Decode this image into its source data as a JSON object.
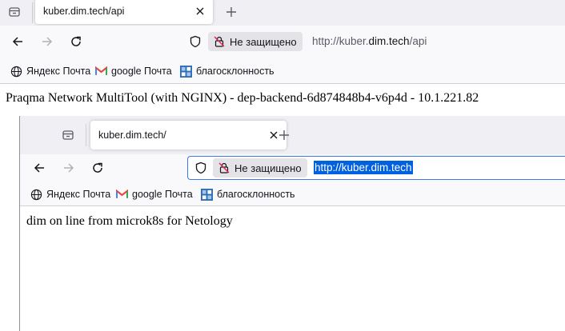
{
  "back_window": {
    "tab_title": "kuber.dim.tech/api",
    "security_label": "Не защищено",
    "url_prefix": "http://kuber.",
    "url_host": "dim.tech",
    "url_suffix": "/api",
    "bookmarks": [
      {
        "label": "Яндекс Почта",
        "icon": "globe-icon"
      },
      {
        "label": "google Почта",
        "icon": "gmail-icon"
      },
      {
        "label": "благосклонность",
        "icon": "grid-favicon"
      }
    ],
    "page_text": "Praqma Network MultiTool (with NGINX) - dep-backend-6d874848b4-v6p4d - 10.1.221.82"
  },
  "front_window": {
    "tab_title": "kuber.dim.tech/",
    "security_label": "Не защищено",
    "url": "http://kuber.dim.tech",
    "url_selected": true,
    "bookmarks": [
      {
        "label": "Яндекс Почта",
        "icon": "globe-icon"
      },
      {
        "label": "google Почта",
        "icon": "gmail-icon"
      },
      {
        "label": "благосклонность",
        "icon": "grid-favicon"
      }
    ],
    "page_text": "dim on line from microk8s for Netology"
  },
  "colors": {
    "tab_strip": "#f0f0f4",
    "toolbar": "#f9f9fb",
    "accent_focus": "#3b79e8",
    "selection": "#0061e0",
    "insecure_badge": "#e3e3e8",
    "insecure_icon": "#e22850",
    "gmail_red": "#ea4335",
    "favicon_blue": "#2d6db5"
  }
}
